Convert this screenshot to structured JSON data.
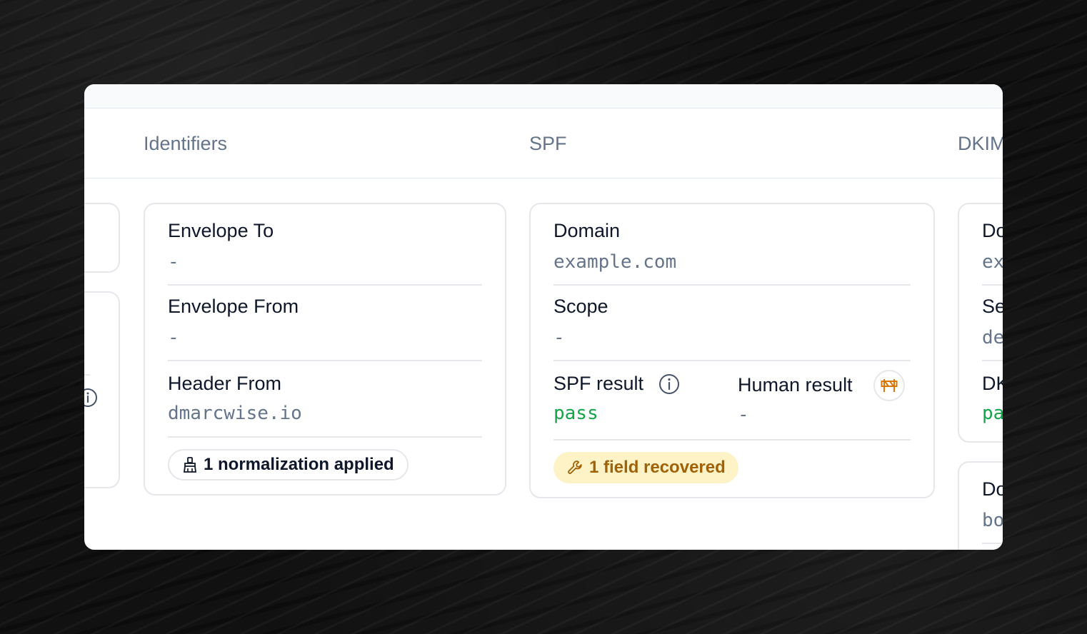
{
  "columns": {
    "identifiers": "Identifiers",
    "spf": "SPF",
    "dkim": "DKIM"
  },
  "identifiers_card": {
    "envelope_to": {
      "label": "Envelope To",
      "value": "-"
    },
    "envelope_from": {
      "label": "Envelope From",
      "value": "-"
    },
    "header_from": {
      "label": "Header From",
      "value": "dmarcwise.io"
    },
    "chip": "1 normalization applied"
  },
  "spf_card": {
    "domain": {
      "label": "Domain",
      "value": "example.com"
    },
    "scope": {
      "label": "Scope",
      "value": "-"
    },
    "spf_result": {
      "label": "SPF result",
      "value": "pass"
    },
    "human_result": {
      "label": "Human result",
      "value": "-"
    },
    "chip": "1 field recovered"
  },
  "dkim_card": {
    "domain": {
      "label": "Domain",
      "value": "example.com"
    },
    "selector": {
      "label": "Selector",
      "value": "default"
    },
    "dkim_result": {
      "label": "DKIM result",
      "value": "pass"
    }
  },
  "dkim_card_2": {
    "domain": {
      "label": "Domain",
      "value": "bounce.example.com"
    }
  },
  "colors": {
    "pass": "#16a34a",
    "warn_bg": "#fef3c7",
    "warn_text": "#a16207",
    "muted": "#64748b"
  },
  "icons": {
    "normalization": "broom-icon",
    "recovered": "wrench-icon",
    "info": "info-icon",
    "human_result": "barrier-icon"
  }
}
